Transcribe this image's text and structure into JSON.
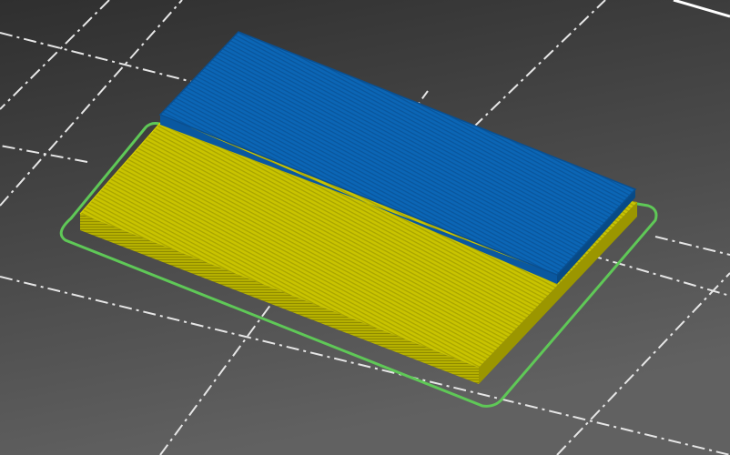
{
  "viewport": {
    "background_top": "#3a3a3a",
    "background_bottom": "#5e5e5e",
    "grid_color": "#e8e8e8",
    "skirt_color": "#5fc857"
  },
  "model": {
    "top_color": "#0a64b4",
    "top_edge_color": "#0a4d8a",
    "yellow_top_color": "#c7c300",
    "yellow_side_color": "#aaa600",
    "yellow_dark_color": "#8e8a00"
  }
}
